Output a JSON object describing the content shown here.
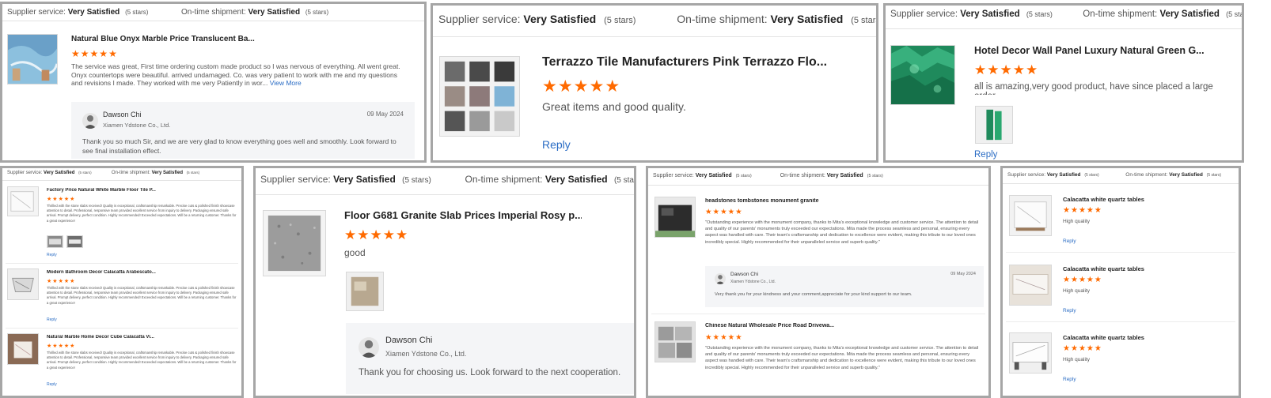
{
  "labels": {
    "supplier_service": "Supplier service:",
    "on_time_shipment": "On-time shipment:",
    "rating_value": "Very Satisfied",
    "stars_note": "(5 stars)",
    "reply": "Reply",
    "view_more": "View More"
  },
  "colors": {
    "star": "#ff6a00",
    "link": "#2a6cc4",
    "border": "#a6a6a6",
    "reply_bg": "#f4f5f7"
  },
  "icons": {
    "star": "star-icon",
    "avatar": "user-avatar-icon"
  },
  "card1": {
    "title": "Natural Blue Onyx Marble Price Translucent Ba...",
    "rating": 5,
    "text": "The service was great, First time ordering custom made product so I was nervous of everything. All went great. Onyx countertops were beautiful. arrived undamaged. Co. was very patient to work with me and my questions and revisions I made. They worked with me very Patiently in wor...",
    "reply": {
      "name": "Dawson Chi",
      "company": "Xiamen Ydstone Co., Ltd.",
      "date": "09 May 2024",
      "text": "Thank you so much Sir, and we are very glad to know everything goes well and smoothly. Look forward to see final installation effect."
    }
  },
  "card2": {
    "title": "Terrazzo Tile Manufacturers Pink Terrazzo Flo...",
    "rating": 5,
    "text": "Great items and good quality."
  },
  "card3": {
    "title": "Hotel Decor Wall Panel Luxury Natural Green G...",
    "rating": 5,
    "text": "all is amazing,very good product, have since placed a large order"
  },
  "card4": {
    "reviews": [
      {
        "title": "Factory Price Natural White Marble Floor Tile P...",
        "rating": 5,
        "text": "Thrilled with the stone slabs received! Quality is exceptional, craftsmanship remarkable. Precise cuts & polished finish showcase attention to detail. Professional, responsive team provided excellent service from inquiry to delivery. Packaging ensured safe arrival. Prompt delivery, perfect condition. Highly recommended! Exceeded expectations. Will be a returning customer. Thanks for a great experience!"
      },
      {
        "title": "Modern Bathroom Decor Calacatta Arabescato...",
        "rating": 5,
        "text": "Thrilled with the stone slabs received! Quality is exceptional, craftsmanship remarkable. Precise cuts & polished finish showcase attention to detail. Professional, responsive team provided excellent service from inquiry to delivery. Packaging ensured safe arrival. Prompt delivery, perfect condition. Highly recommended! Exceeded expectations. Will be a returning customer. Thanks for a great experience!"
      },
      {
        "title": "Natural Marble Home Decor Cube Calacatta Vi...",
        "rating": 5,
        "text": "Thrilled with the stone slabs received! Quality is exceptional, craftsmanship remarkable. Precise cuts & polished finish showcase attention to detail. Professional, responsive team provided excellent service from inquiry to delivery. Packaging ensured safe arrival. Prompt delivery, perfect condition. Highly recommended! Exceeded expectations. Will be a returning customer. Thanks for a great experience!"
      }
    ]
  },
  "card5": {
    "title": "Floor G681 Granite Slab Prices Imperial Rosy p...",
    "rating": 5,
    "text": "good",
    "reply": {
      "name": "Dawson Chi",
      "company": "Xiamen Ydstone Co., Ltd.",
      "text": "Thank you for choosing us. Look forward to the next cooperation."
    }
  },
  "card6": {
    "reviews": [
      {
        "title": "headstones tombstones monument granite",
        "rating": 5,
        "text": "\"Outstanding experience with the monument company, thanks to Mita's exceptional knowledge and customer service. The attention to detail and quality of our parents' monuments truly exceeded our expectations. Mita made the process seamless and personal, ensuring every aspect was handled with care. Their team's craftsmanship and dedication to excellence were evident, making this tribute to our loved ones incredibly special. Highly recommended for their unparalleled service and superb quality.\"",
        "reply": {
          "name": "Dawson Chi",
          "company": "Xiamen Ydstone Co., Ltd.",
          "date": "09 May 2024",
          "text": "Very thank you for your kindness and your comment,appreciate for your kind support to our team."
        }
      },
      {
        "title": "Chinese Natural Wholesale Price Road Drivewa...",
        "rating": 5,
        "text": "\"Outstanding experience with the monument company, thanks to Mita's exceptional knowledge and customer service. The attention to detail and quality of our parents' monuments truly exceeded our expectations. Mita made the process seamless and personal, ensuring every aspect was handled with care. Their team's craftsmanship and dedication to excellence were evident, making this tribute to our loved ones incredibly special. Highly recommended for their unparalleled service and superb quality.\""
      }
    ]
  },
  "card7": {
    "reviews": [
      {
        "title": "Calacatta white quartz tables",
        "rating": 5,
        "text": "High quality"
      },
      {
        "title": "Calacatta white quartz tables",
        "rating": 5,
        "text": "High quality"
      },
      {
        "title": "Calacatta white quartz tables",
        "rating": 5,
        "text": "High quality"
      }
    ]
  }
}
